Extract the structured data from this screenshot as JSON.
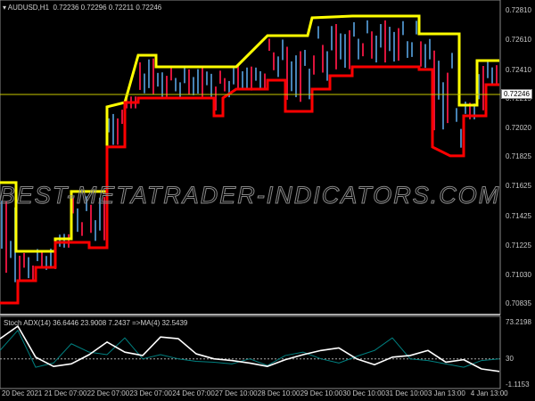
{
  "header": {
    "symbol": "AUDUSD,H1",
    "ohlc": "0.72236 0.72296 0.72211 0.72246"
  },
  "watermark": "BEST-METATRADER-INDICATORS.COM",
  "current_price": "0.72246",
  "indicator_header": "Stoch ADX(14) 36.6446 23.9008 7.2437  =>MA(4) 32.5439",
  "colors": {
    "upper": "#ffff00",
    "lower": "#ff0000",
    "adx": "#ffffff",
    "di": "#008080",
    "hline": "#c8c800"
  },
  "chart_data": [
    {
      "type": "line",
      "title": "AUDUSD,H1",
      "price_axis": [
        "0.72810",
        "0.72610",
        "0.72410",
        "0.72215",
        "0.72020",
        "0.71825",
        "0.71625",
        "0.71425",
        "0.71225",
        "0.71030",
        "0.70835"
      ],
      "ylim": [
        0.70835,
        0.7281
      ],
      "time_labels": [
        "20 Dec 2021",
        "21 Dec 07:00",
        "22 Dec 07:00",
        "23 Dec 07:00",
        "24 Dec 07:00",
        "27 Dec 10:00",
        "28 Dec 10:00",
        "29 Dec 10:00",
        "30 Dec 10:00",
        "31 Dec 10:00",
        "3 Jan 13:00",
        "4 Jan 13:00"
      ],
      "series": [
        {
          "name": "Upper band",
          "points": [
            [
              0,
              0.71652
            ],
            [
              3.6,
              0.71652
            ],
            [
              3.6,
              0.71189
            ],
            [
              12.4,
              0.71189
            ],
            [
              12.4,
              0.71273
            ],
            [
              16,
              0.71273
            ],
            [
              16,
              0.71592
            ],
            [
              24,
              0.71592
            ],
            [
              24,
              0.72162
            ],
            [
              28,
              0.72192
            ],
            [
              31,
              0.7251
            ],
            [
              35,
              0.7251
            ],
            [
              35,
              0.72432
            ],
            [
              53,
              0.72432
            ],
            [
              60,
              0.72642
            ],
            [
              69,
              0.72642
            ],
            [
              70,
              0.72762
            ],
            [
              79,
              0.72774
            ],
            [
              94,
              0.72774
            ],
            [
              94,
              0.72654
            ],
            [
              103,
              0.72654
            ],
            [
              103,
              0.72174
            ],
            [
              107,
              0.72174
            ],
            [
              107,
              0.72474
            ],
            [
              112,
              0.72474
            ]
          ]
        },
        {
          "name": "Lower band",
          "points": [
            [
              0,
              0.70841
            ],
            [
              4,
              0.70841
            ],
            [
              4,
              0.70991
            ],
            [
              8,
              0.70991
            ],
            [
              8,
              0.71081
            ],
            [
              12.4,
              0.71081
            ],
            [
              12.4,
              0.71249
            ],
            [
              20,
              0.71249
            ],
            [
              20,
              0.71213
            ],
            [
              24,
              0.71213
            ],
            [
              24,
              0.71892
            ],
            [
              28,
              0.71892
            ],
            [
              28,
              0.72192
            ],
            [
              31,
              0.72192
            ],
            [
              31,
              0.72222
            ],
            [
              39,
              0.72222
            ],
            [
              48,
              0.72222
            ],
            [
              48,
              0.72102
            ],
            [
              50,
              0.72102
            ],
            [
              50,
              0.72222
            ],
            [
              53,
              0.72282
            ],
            [
              60,
              0.72282
            ],
            [
              60,
              0.72342
            ],
            [
              64,
              0.72342
            ],
            [
              64,
              0.72132
            ],
            [
              70,
              0.72132
            ],
            [
              70,
              0.72282
            ],
            [
              74,
              0.72282
            ],
            [
              74,
              0.72372
            ],
            [
              79,
              0.72372
            ],
            [
              79,
              0.72432
            ],
            [
              94,
              0.72432
            ],
            [
              94,
              0.72414
            ],
            [
              97,
              0.72414
            ],
            [
              97,
              0.71892
            ],
            [
              101,
              0.71832
            ],
            [
              104,
              0.71832
            ],
            [
              104,
              0.72102
            ],
            [
              109,
              0.72102
            ],
            [
              109,
              0.72312
            ],
            [
              112,
              0.72312
            ]
          ]
        }
      ]
    },
    {
      "type": "line",
      "title": "Stoch ADX(14)",
      "ylim": [
        -1.1153,
        73.2198
      ],
      "axis_labels": [
        "73.2198",
        "30",
        "-1.1153"
      ],
      "level": 30,
      "series": [
        {
          "name": "ADX",
          "values": [
            54,
            69,
            32,
            21,
            24,
            35,
            50,
            38,
            34,
            56,
            54,
            36,
            30,
            28,
            25,
            21,
            29,
            35,
            40,
            43,
            30,
            23,
            32,
            34,
            40,
            26,
            29,
            18,
            15
          ]
        },
        {
          "name": "DI",
          "values": [
            40,
            64,
            20,
            25,
            48,
            38,
            35,
            55,
            30,
            35,
            30,
            27,
            26,
            24,
            30,
            22,
            34,
            38,
            30,
            25,
            33,
            40,
            55,
            30,
            28,
            24,
            20,
            28,
            30
          ]
        }
      ]
    }
  ]
}
